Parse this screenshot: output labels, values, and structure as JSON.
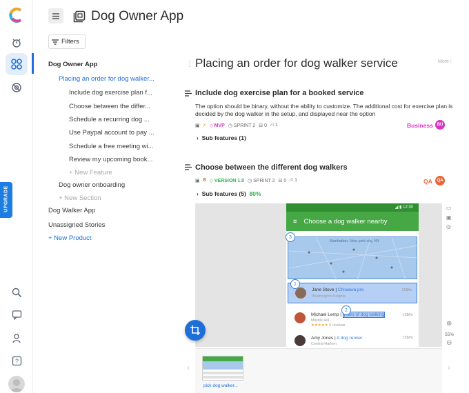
{
  "header": {
    "title": "Dog Owner App",
    "filters_label": "Filters"
  },
  "sidebar_rail": {
    "upgrade_label": "UPGRADE"
  },
  "tree": {
    "product": "Dog Owner App",
    "epic_active": "Placing an order for dog walker...",
    "features": [
      "Include dog exercise plan f...",
      "Choose between the differ...",
      "Schedule a recurring dog ...",
      "Use Paypal account to pay ...",
      "Schedule a free meeting wi...",
      "Review my upcoming book..."
    ],
    "new_feature": "+ New Feature",
    "epic2": "Dog owner onboarding",
    "new_section": "+ New Section",
    "product2": "Dog Walker App",
    "unassigned": "Unassigned Stories",
    "new_product": "+ New Product"
  },
  "detail": {
    "title": "Placing an order for dog walker service",
    "more": "More",
    "feature1": {
      "title": "Include dog exercise plan for a booked service",
      "desc": "The option should be binary, without the ability to customize. The additional cost for exercise plan is decided by the dog walker in the setup, and displayed near the option",
      "badge": "MVP",
      "sprint": "SPRINT 2",
      "comments": "0",
      "links": "1",
      "tag": "Business",
      "tag_initials": "BU",
      "subfeatures": "Sub features (1)"
    },
    "feature2": {
      "title": "Choose between the different dog walkers",
      "num": "8",
      "badge": "VERSION 1.0",
      "sprint": "SPRINT 2",
      "comments": "0",
      "links": "1",
      "tag": "QA",
      "tag_initials": "QA",
      "subfeatures": "Sub features (5)",
      "progress": "80%"
    }
  },
  "mockup": {
    "time": "12:30",
    "appbar": "Choose a dog walker nearby",
    "map_location": "Manhattan, New york city, NY",
    "people": [
      {
        "name": "Jane Stove",
        "role": "Chiwawa pro",
        "area": "Washington Heights",
        "price": "15$/hr"
      },
      {
        "name": "Michael Lemp",
        "role": "years of dog walking",
        "area": "Marble Hill",
        "price": "15$/hr",
        "reviews": "6 reviews"
      },
      {
        "name": "Amy Jones",
        "role": "A dog runner",
        "area": "Central Harlem",
        "price": "15$/hr"
      }
    ],
    "callouts": [
      "3",
      "1",
      "2"
    ]
  },
  "viewer": {
    "zoom": "55%",
    "thumb_label": "pick dog walker..."
  },
  "colors": {
    "accent": "#1e6fd9",
    "green": "#45a845",
    "magenta": "#d936c4",
    "qa": "#e8663a"
  }
}
